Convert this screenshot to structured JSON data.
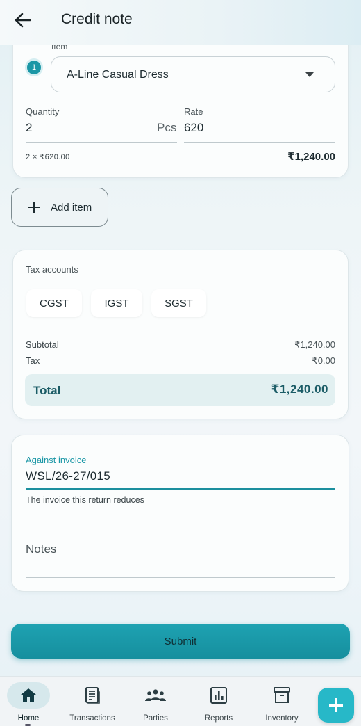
{
  "appbar": {
    "title": "Credit note"
  },
  "item": {
    "index": "1",
    "field_label": "Item",
    "selected": "A-Line Casual Dress",
    "quantity_label": "Quantity",
    "quantity_value": "2",
    "unit": "Pcs",
    "rate_label": "Rate",
    "rate_value": "620",
    "calc": "2 × ₹620.00",
    "line_total": "₹1,240.00"
  },
  "add_item_label": "Add item",
  "tax": {
    "heading": "Tax accounts",
    "chips": [
      "CGST",
      "IGST",
      "SGST"
    ],
    "subtotal_label": "Subtotal",
    "subtotal_value": "₹1,240.00",
    "tax_label": "Tax",
    "tax_value": "₹0.00",
    "total_label": "Total",
    "total_value": "₹1,240.00"
  },
  "invoice": {
    "label": "Against invoice",
    "value": "WSL/26-27/015",
    "helper": "The invoice this return reduces",
    "notes_label": "Notes"
  },
  "submit_label": "Submit",
  "nav": {
    "items": [
      {
        "label": "Home",
        "icon": "home-icon",
        "active": true
      },
      {
        "label": "Transactions",
        "icon": "receipt-icon",
        "active": false
      },
      {
        "label": "Parties",
        "icon": "people-icon",
        "active": false
      },
      {
        "label": "Reports",
        "icon": "bar-chart-icon",
        "active": false
      },
      {
        "label": "Inventory",
        "icon": "archive-box-icon",
        "active": false
      }
    ],
    "fab_icon": "plus-icon"
  },
  "colors": {
    "accent": "#1b97a6",
    "total_bg": "#e2f0f1",
    "total_text": "#1b5c66"
  }
}
